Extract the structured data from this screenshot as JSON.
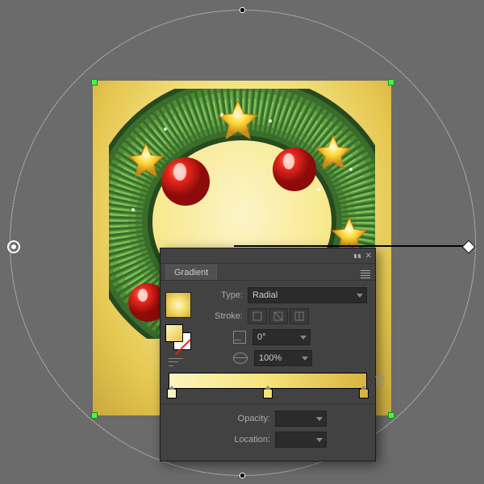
{
  "panel": {
    "tab_label": "Gradient",
    "type_label": "Type:",
    "type_value": "Radial",
    "stroke_label": "Stroke:",
    "angle_value": "0°",
    "aspect_value": "100%",
    "opacity_label": "Opacity:",
    "opacity_value": "",
    "location_label": "Location:",
    "location_value": ""
  },
  "gradient_stops": [
    {
      "pos": 0,
      "color": "#fdf4c0"
    },
    {
      "pos": 50,
      "color": "#f5e378"
    },
    {
      "pos": 100,
      "color": "#d9b340"
    }
  ]
}
